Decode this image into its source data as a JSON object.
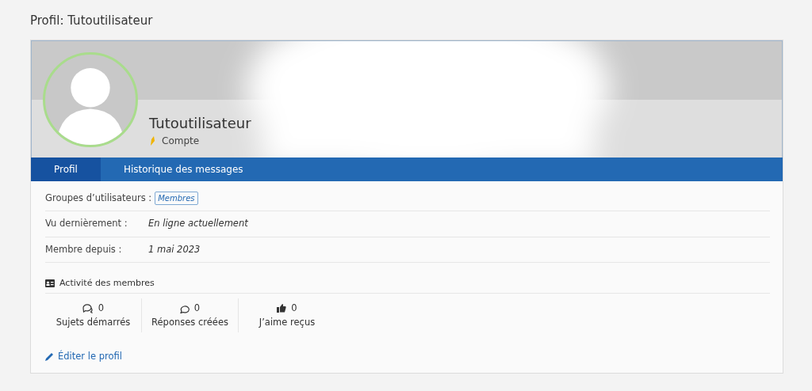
{
  "page_title": "Profil: Tutoutilisateur",
  "profile": {
    "username": "Tutoutilisateur",
    "rank": "Compte"
  },
  "tabs": [
    {
      "label": "Profil",
      "selected": true
    },
    {
      "label": "Historique des messages",
      "selected": false
    }
  ],
  "fields": [
    {
      "label": "Groupes d’utilisateurs :",
      "value": "Membres",
      "kind": "badge"
    },
    {
      "label": "Vu dernièrement :",
      "value": "En ligne actuellement",
      "kind": "text"
    },
    {
      "label": "Membre depuis :",
      "value": "1 mai 2023",
      "kind": "text"
    }
  ],
  "activity": {
    "title": "Activité des membres",
    "stats": [
      {
        "kind": "topics",
        "count": "0",
        "label": "Sujets démarrés"
      },
      {
        "kind": "replies",
        "count": "0",
        "label": "Réponses créées"
      },
      {
        "kind": "likes",
        "count": "0",
        "label": "J’aime reçus"
      }
    ]
  },
  "edit_link": "Éditer le profil"
}
